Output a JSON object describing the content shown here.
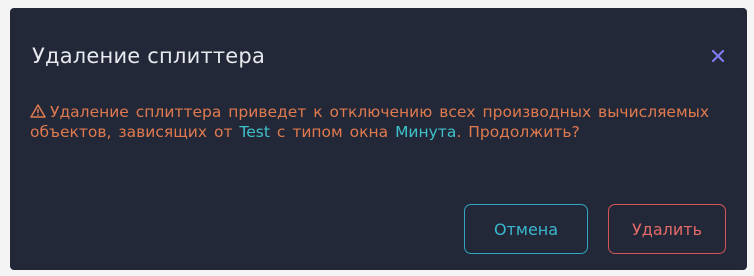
{
  "dialog": {
    "title": "Удаление сплиттера",
    "close_icon": "close-x-icon",
    "message": {
      "warning_icon": "warning-triangle-icon",
      "part1": "Удаление сплиттера приведет к отключению всех производных вычисляемых объектов, зависящих от ",
      "entity_name": "Test",
      "part2": " с типом окна ",
      "window_type": "Минута",
      "part3": ". Продолжить?"
    },
    "buttons": {
      "cancel_label": "Отмена",
      "delete_label": "Удалить"
    }
  },
  "colors": {
    "background": "#232838",
    "title": "#e7e9ee",
    "warning_text": "#e07a4e",
    "highlight": "#3ec1c9",
    "cancel_accent": "#2fa7bf",
    "delete_accent": "#d4545a"
  }
}
